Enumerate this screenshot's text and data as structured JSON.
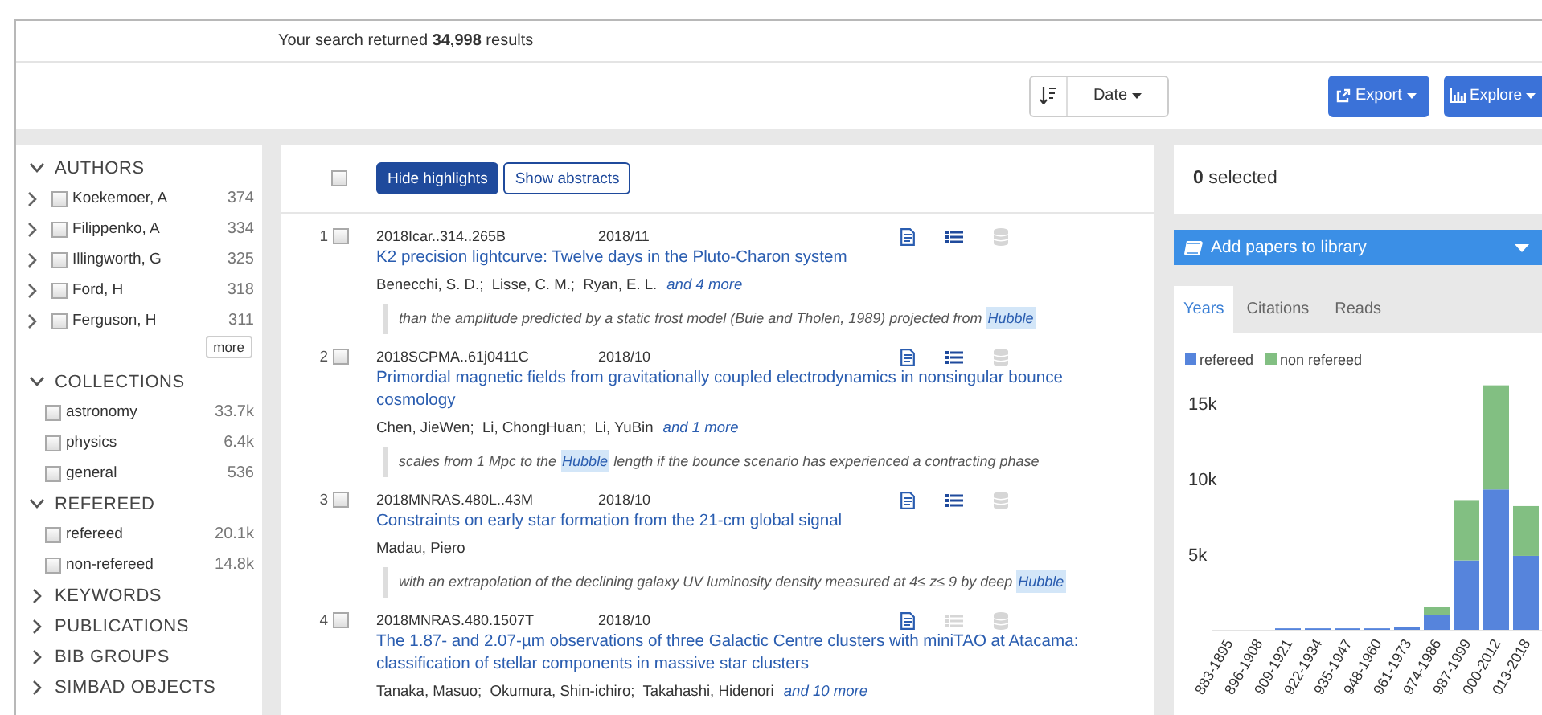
{
  "summary": "Your search returned **34,998** results",
  "toolbar": {
    "sort": {
      "label": "Date"
    },
    "buttons": [
      {
        "label": "Export",
        "kind": "export"
      },
      {
        "label": "Explore",
        "kind": "explore"
      }
    ]
  },
  "facets": [
    {
      "title": "AUTHORS",
      "expanded": true,
      "items": [
        {
          "label": "Koekemoer, A",
          "count": "374",
          "checked": false,
          "expandable": true
        },
        {
          "label": "Filippenko, A",
          "count": "334",
          "checked": false,
          "expandable": true
        },
        {
          "label": "Illingworth, G",
          "count": "325",
          "checked": false,
          "expandable": true
        },
        {
          "label": "Ford, H",
          "count": "318",
          "checked": false,
          "expandable": true
        },
        {
          "label": "Ferguson, H",
          "count": "311",
          "checked": false,
          "expandable": true
        }
      ],
      "more": "more"
    },
    {
      "title": "COLLECTIONS",
      "expanded": true,
      "items": [
        {
          "label": "astronomy",
          "count": "33.7k",
          "checked": false,
          "expandable": false
        },
        {
          "label": "physics",
          "count": "6.4k",
          "checked": false,
          "expandable": false
        },
        {
          "label": "general",
          "count": "536",
          "checked": false,
          "expandable": false
        }
      ]
    },
    {
      "title": "REFEREED",
      "expanded": true,
      "items": [
        {
          "label": "refereed",
          "count": "20.1k",
          "checked": false,
          "expandable": false
        },
        {
          "label": "non-refereed",
          "count": "14.8k",
          "checked": false,
          "expandable": false
        }
      ]
    },
    {
      "title": "KEYWORDS",
      "expanded": false
    },
    {
      "title": "PUBLICATIONS",
      "expanded": false
    },
    {
      "title": "BIB GROUPS",
      "expanded": false
    },
    {
      "title": "SIMBAD OBJECTS",
      "expanded": false
    }
  ],
  "results_header": {
    "select_all_checked": false,
    "buttons": [
      {
        "label": "Hide highlights",
        "selected": true
      },
      {
        "label": "Show abstracts",
        "selected": false
      }
    ]
  },
  "results": [
    {
      "index": "1",
      "checked": false,
      "bibcode": "2018Icar..314..265B",
      "date": "2018/11",
      "title": "K2 precision lightcurve: Twelve days in the Pluto-Charon system",
      "authors": "Benecchi, S. D.;  Lisse, C. M.;  Ryan, E. L.",
      "more_authors": "and 4 more",
      "links": [
        {
          "kind": "abstract",
          "disabled": false
        },
        {
          "kind": "references",
          "disabled": false
        },
        {
          "kind": "data",
          "disabled": true
        }
      ],
      "snippet": [
        {
          "text": "than the amplitude predicted by a static frost model (Buie and Tholen, 1989) projected from ",
          "highlighted": false
        },
        {
          "text": "Hubble",
          "highlighted": true
        }
      ]
    },
    {
      "index": "2",
      "checked": false,
      "bibcode": "2018SCPMA..61j0411C",
      "date": "2018/10",
      "title": "Primordial magnetic fields from gravitationally coupled electrodynamics in nonsingular bounce cosmology",
      "authors": "Chen, JieWen;  Li, ChongHuan;  Li, YuBin",
      "more_authors": "and 1 more",
      "links": [
        {
          "kind": "abstract",
          "disabled": false
        },
        {
          "kind": "references",
          "disabled": false
        },
        {
          "kind": "data",
          "disabled": true
        }
      ],
      "snippet": [
        {
          "text": "scales from 1 Mpc to the ",
          "highlighted": false
        },
        {
          "text": "Hubble",
          "highlighted": true
        },
        {
          "text": " length if the bounce scenario has experienced a contracting phase",
          "highlighted": false
        }
      ]
    },
    {
      "index": "3",
      "checked": false,
      "bibcode": "2018MNRAS.480L..43M",
      "date": "2018/10",
      "title": "Constraints on early star formation from the 21-cm global signal",
      "authors": "Madau, Piero",
      "links": [
        {
          "kind": "abstract",
          "disabled": false
        },
        {
          "kind": "references",
          "disabled": false
        },
        {
          "kind": "data",
          "disabled": true
        }
      ],
      "snippet": [
        {
          "text": "with an extrapolation of the declining galaxy UV luminosity density measured at 4≤ z≤ 9 by deep ",
          "highlighted": false
        },
        {
          "text": "Hubble",
          "highlighted": true
        }
      ]
    },
    {
      "index": "4",
      "checked": false,
      "bibcode": "2018MNRAS.480.1507T",
      "date": "2018/10",
      "title": "The 1.87- and 2.07-µm observations of three Galactic Centre clusters with miniTAO at Atacama: classification of stellar components in massive star clusters",
      "authors": "Tanaka, Masuo;  Okumura, Shin-ichiro;  Takahashi, Hidenori",
      "more_authors": "and 10 more",
      "links": [
        {
          "kind": "abstract",
          "disabled": false
        },
        {
          "kind": "references",
          "disabled": true
        },
        {
          "kind": "data",
          "disabled": true
        }
      ]
    }
  ],
  "side": {
    "selected": "**0** selected",
    "library": "Add papers to library",
    "tabs": [
      {
        "label": "Years",
        "selected": true
      },
      {
        "label": "Citations",
        "selected": false
      },
      {
        "label": "Reads",
        "selected": false
      }
    ],
    "chart_data": {
      "type": "bar",
      "stacked": true,
      "categories": [
        "883-1895",
        "896-1908",
        "909-1921",
        "922-1934",
        "935-1947",
        "948-1960",
        "961-1973",
        "974-1986",
        "987-1999",
        "000-2012",
        "013-2018"
      ],
      "series": [
        {
          "name": "refereed",
          "color": "#5684dc",
          "values": [
            0,
            0,
            100,
            100,
            100,
            100,
            200,
            1000,
            4600,
            9300,
            4900
          ]
        },
        {
          "name": "non refereed",
          "color": "#82bf82",
          "values": [
            0,
            0,
            0,
            0,
            0,
            0,
            0,
            500,
            4000,
            6900,
            3300
          ]
        }
      ],
      "ylim": [
        0,
        16500
      ],
      "legend": true,
      "yticks": [
        {
          "value": 5000,
          "label": "5k"
        },
        {
          "value": 10000,
          "label": "10k"
        },
        {
          "value": 15000,
          "label": "15k"
        }
      ]
    }
  }
}
